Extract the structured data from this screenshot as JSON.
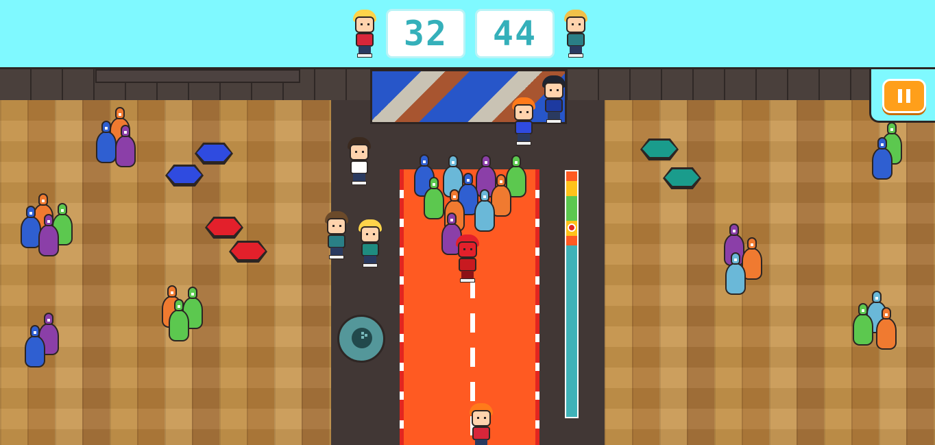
{
  "hud": {
    "player_score": "32",
    "opponent_score": "44"
  },
  "controls": {
    "pause_icon": "pause-icon",
    "throw_icon": "bowling-ball-icon"
  },
  "power_meter": {
    "marker_fraction": 0.23,
    "colors": [
      "#ff5a22",
      "#ffc21a",
      "#5cc84f",
      "#ffc21a",
      "#ff5a22",
      "#3fb2b8"
    ]
  },
  "palette": {
    "lane": "#ff5a22",
    "hud_bg": "#7ff9ff",
    "score_text": "#35b0ba",
    "pause_button": "#ff9f1a"
  }
}
